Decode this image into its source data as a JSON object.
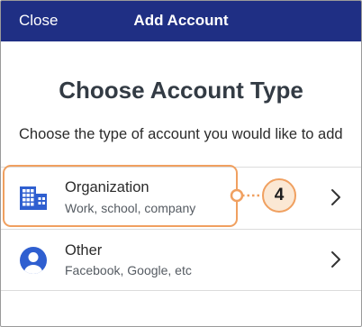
{
  "nav": {
    "close_label": "Close",
    "title": "Add Account"
  },
  "main": {
    "heading": "Choose Account Type",
    "subheading": "Choose the type of account you would like to add"
  },
  "options": [
    {
      "title": "Organization",
      "subtitle": "Work, school, company",
      "icon": "building-icon"
    },
    {
      "title": "Other",
      "subtitle": "Facebook, Google, etc",
      "icon": "person-icon"
    }
  ],
  "annotation": {
    "step_number": "4"
  },
  "colors": {
    "nav_background": "#1f2f84",
    "icon_blue": "#2f5fd0",
    "highlight_orange": "#f0a060",
    "badge_fill": "#fbe8d4"
  }
}
